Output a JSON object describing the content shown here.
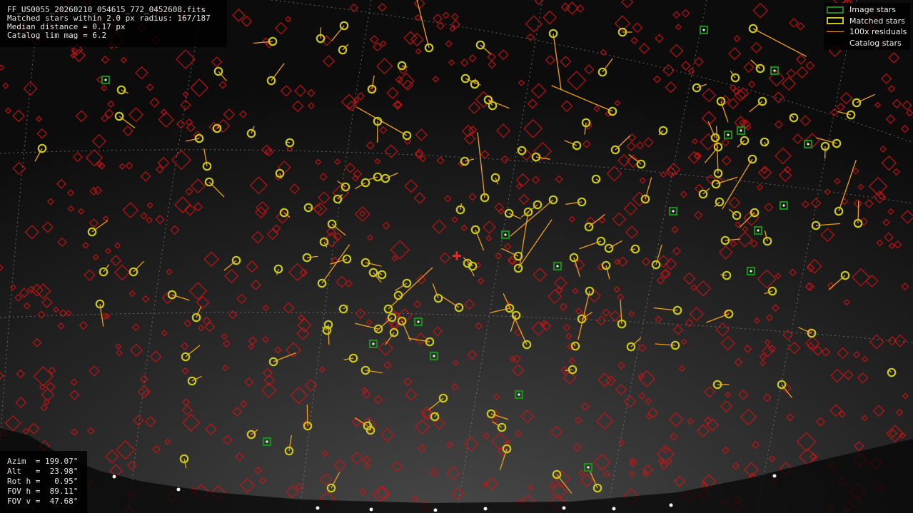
{
  "header": {
    "filename": "FF_US0055_20260210_054615_772_0452608.fits",
    "matched_stars": "Matched stars within 2.0 px radius: 167/187",
    "median_distance": "Median distance = 0.17 px",
    "catalog_limit": "Catalog lim mag = 6.2"
  },
  "legend": {
    "items": [
      {
        "label": "Image stars",
        "style": "green"
      },
      {
        "label": "Matched stars",
        "style": "yellow"
      },
      {
        "label": "100x residuals",
        "style": "line"
      },
      {
        "label": "Catalog stars",
        "style": "none"
      }
    ]
  },
  "pointing": {
    "azim": "Azim  = 199.07°",
    "alt": "Alt   =  23.98°",
    "rot": "Rot h =   0.95°",
    "fov_h": "FOV h =  89.11°",
    "fov_v": "FOV v =  47.68°"
  },
  "colors": {
    "image_star": "#1c8a1c",
    "matched_star": "#c8c818",
    "residual": "#f0a020",
    "catalog_star": "#cc1414",
    "center_marker": "#ff2020",
    "grid": "#8a8a8a"
  }
}
